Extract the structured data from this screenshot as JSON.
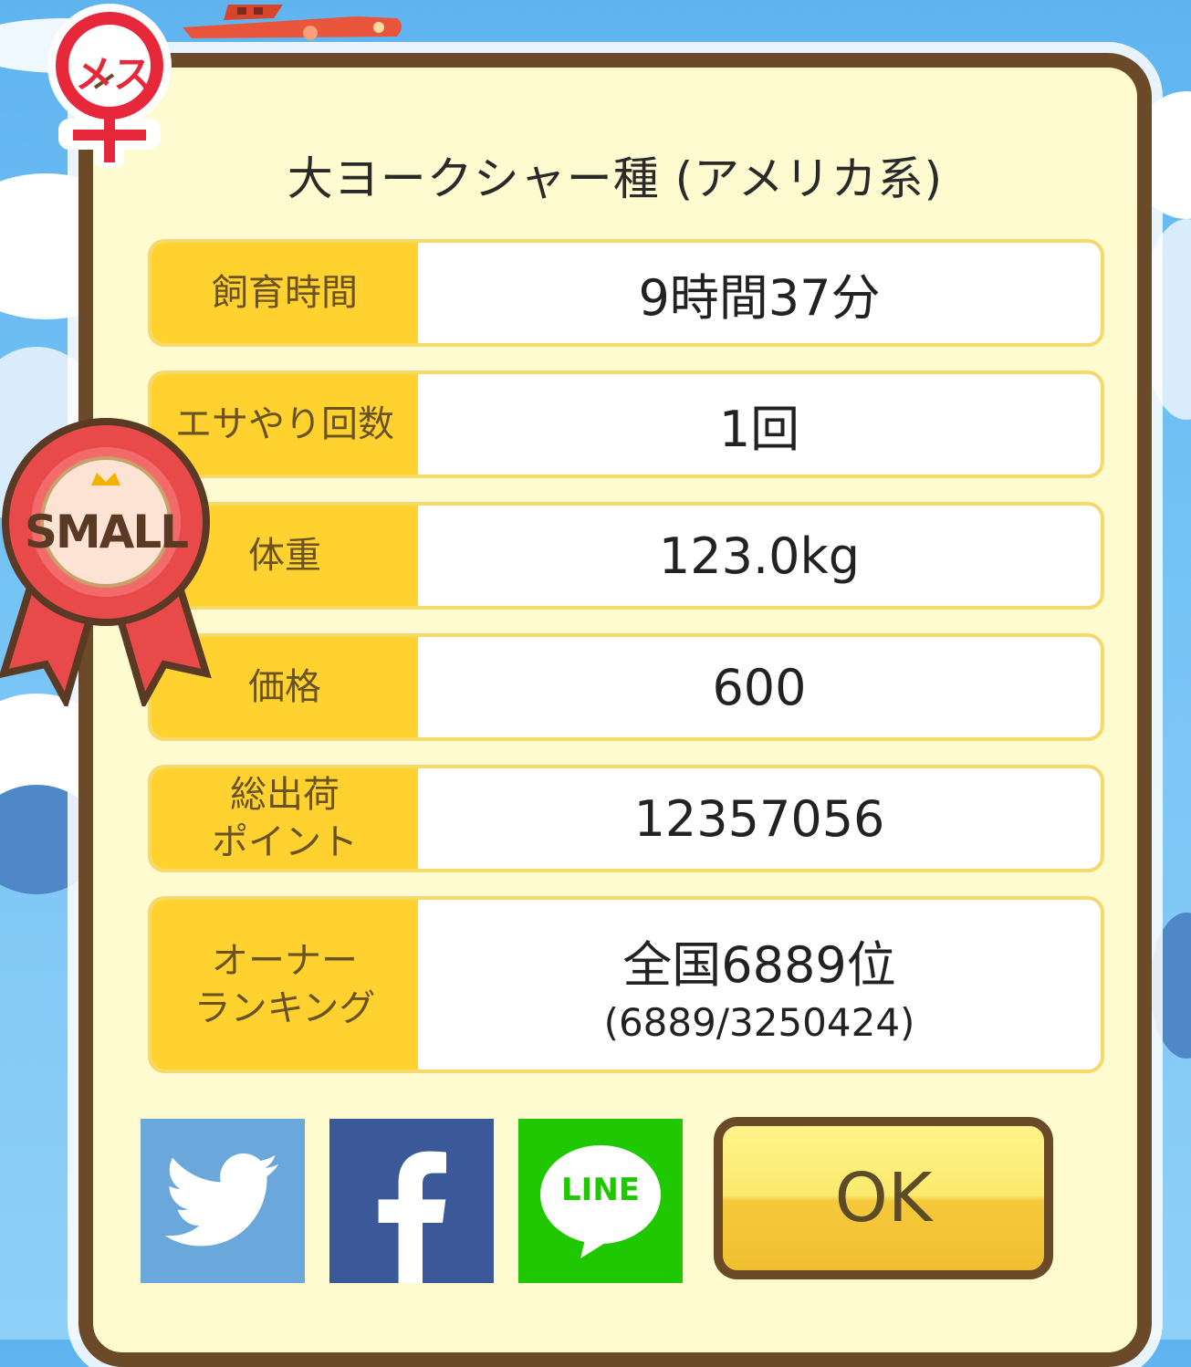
{
  "badges": {
    "gender": "メス",
    "size": "SMALL"
  },
  "title": "大ヨークシャー種 (アメリカ系)",
  "rows": [
    {
      "label": "飼育時間",
      "value": "9時間37分"
    },
    {
      "label": "エサやり回数",
      "value": "1回"
    },
    {
      "label": "体重",
      "value": "123.0kg"
    },
    {
      "label": "価格",
      "value": "600"
    },
    {
      "label_line1": "総出荷",
      "label_line2": "ポイント",
      "value": "12357056"
    },
    {
      "label_line1": "オーナー",
      "label_line2": "ランキング",
      "value": "全国6889位",
      "sub": "(6889/3250424)"
    }
  ],
  "social": {
    "twitter_icon": "twitter-bird-icon",
    "facebook_icon": "facebook-f-icon",
    "line_text": "LINE"
  },
  "ok_label": "OK",
  "colors": {
    "frame": "#6b4a2a",
    "panel": "#fffbd0",
    "label_bg": "#ffd230",
    "twitter": "#6aa8dc",
    "facebook": "#3b5998",
    "line": "#1fc800"
  }
}
